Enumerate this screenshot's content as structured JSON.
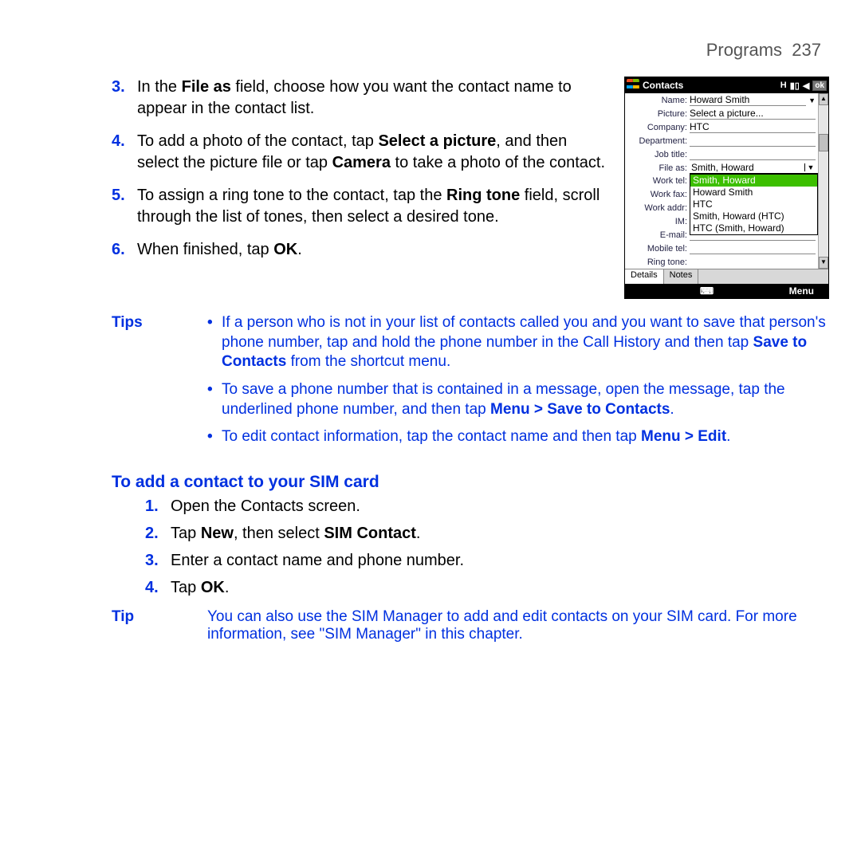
{
  "header": {
    "section": "Programs",
    "page": "237"
  },
  "steps": [
    {
      "n": "3.",
      "pre": "In the ",
      "b1": "File as",
      "mid": " field, choose how you want the contact name to appear in the contact list."
    },
    {
      "n": "4.",
      "pre": "To add a photo of the contact, tap ",
      "b1": "Select a picture",
      "mid": ", and then select the picture file or tap ",
      "b2": "Camera",
      "post": " to take a photo of the contact."
    },
    {
      "n": "5.",
      "pre": "To assign a ring tone to the contact, tap the ",
      "b1": "Ring tone",
      "mid": " field, scroll through the list of tones, then select a desired tone."
    },
    {
      "n": "6.",
      "pre": "When finished, tap ",
      "b1": "OK",
      "mid": "."
    }
  ],
  "phone": {
    "title": "Contacts",
    "ok": "ok",
    "fields": {
      "Name": "Howard Smith",
      "Picture": "Select a picture...",
      "Company": "HTC",
      "Department": "",
      "Job_title": "",
      "File_as": "Smith, Howard",
      "Work_tel": "",
      "Work_fax": "",
      "Work_addr": "",
      "IM": "",
      "E-mail": "",
      "Mobile_tel": "",
      "Ring_tone": ""
    },
    "labels": {
      "Name": "Name:",
      "Picture": "Picture:",
      "Company": "Company:",
      "Department": "Department:",
      "Job_title": "Job title:",
      "File_as": "File as:",
      "Work_tel": "Work tel:",
      "Work_fax": "Work fax:",
      "Work_addr": "Work addr:",
      "IM": "IM:",
      "E_mail": "E-mail:",
      "Mobile_tel": "Mobile tel:",
      "Ring_tone": "Ring tone:"
    },
    "fileas_options": [
      "Smith, Howard",
      "Howard Smith",
      "HTC",
      "Smith, Howard (HTC)",
      "HTC (Smith, Howard)"
    ],
    "fileas_selected_index": 0,
    "tabs": [
      "Details",
      "Notes"
    ],
    "menu": "Menu"
  },
  "tipsLabel": "Tips",
  "tips": [
    {
      "pre": "If a person who is not in your list of contacts called you and you want to save that person's phone number, tap and hold the phone number in the Call History and then tap ",
      "b1": "Save to Contacts",
      "mid": " from the shortcut menu."
    },
    {
      "pre": "To save a phone number that is contained in a message, open the message, tap the underlined phone number, and then tap ",
      "b1": "Menu > Save to Contacts",
      "mid": "."
    },
    {
      "pre": "To edit contact information, tap the contact name and then tap ",
      "b1": "Menu > Edit",
      "mid": "."
    }
  ],
  "subhead": "To add a contact to your SIM card",
  "steps2": [
    {
      "n": "1.",
      "pre": "Open the Contacts screen."
    },
    {
      "n": "2.",
      "pre": "Tap ",
      "b1": "New",
      "mid": ", then select ",
      "b2": "SIM Contact",
      "post": "."
    },
    {
      "n": "3.",
      "pre": "Enter a contact name and phone number."
    },
    {
      "n": "4.",
      "pre": "Tap ",
      "b1": "OK",
      "mid": "."
    }
  ],
  "tip2Label": "Tip",
  "tip2": "You can also use the SIM Manager to add and edit contacts on your SIM card. For more information, see \"SIM Manager\" in this chapter."
}
